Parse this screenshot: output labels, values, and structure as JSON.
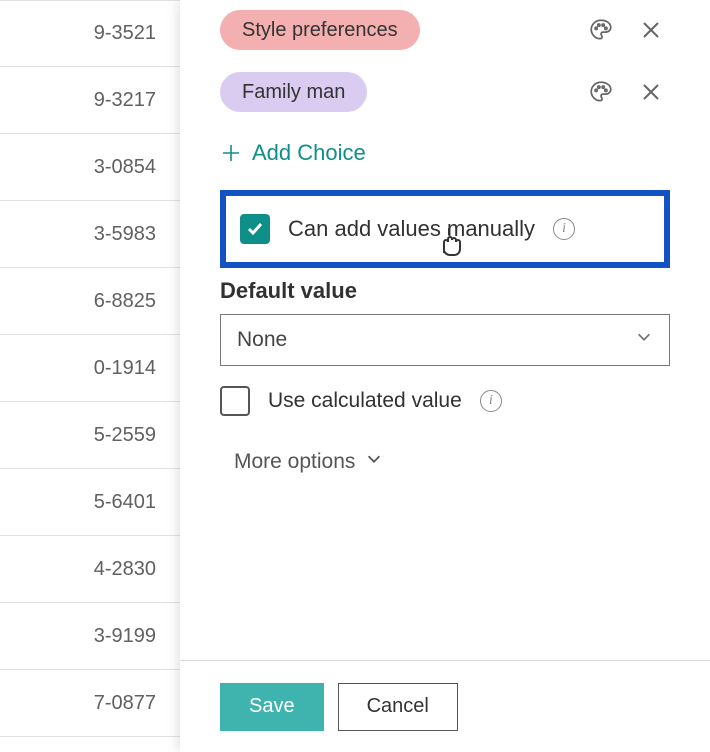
{
  "list": {
    "rows": [
      "9-3521",
      "9-3217",
      "3-0854",
      "3-5983",
      "6-8825",
      "0-1914",
      "5-2559",
      "5-6401",
      "4-2830",
      "3-9199",
      "7-0877"
    ]
  },
  "panel": {
    "choices": [
      {
        "label": "Style preferences",
        "color": "pink"
      },
      {
        "label": "Family man",
        "color": "lilac"
      }
    ],
    "add_choice_label": "Add Choice",
    "manual_add": {
      "label": "Can add values manually",
      "checked": true
    },
    "default_section_label": "Default value",
    "default_value": "None",
    "use_calculated": {
      "label": "Use calculated value",
      "checked": false
    },
    "more_options_label": "More options",
    "save_label": "Save",
    "cancel_label": "Cancel"
  },
  "colors": {
    "accent": "#0f8f8a",
    "highlight": "#1252c2",
    "chip_pink": "#f4b0b0",
    "chip_lilac": "#d9ccf0"
  }
}
